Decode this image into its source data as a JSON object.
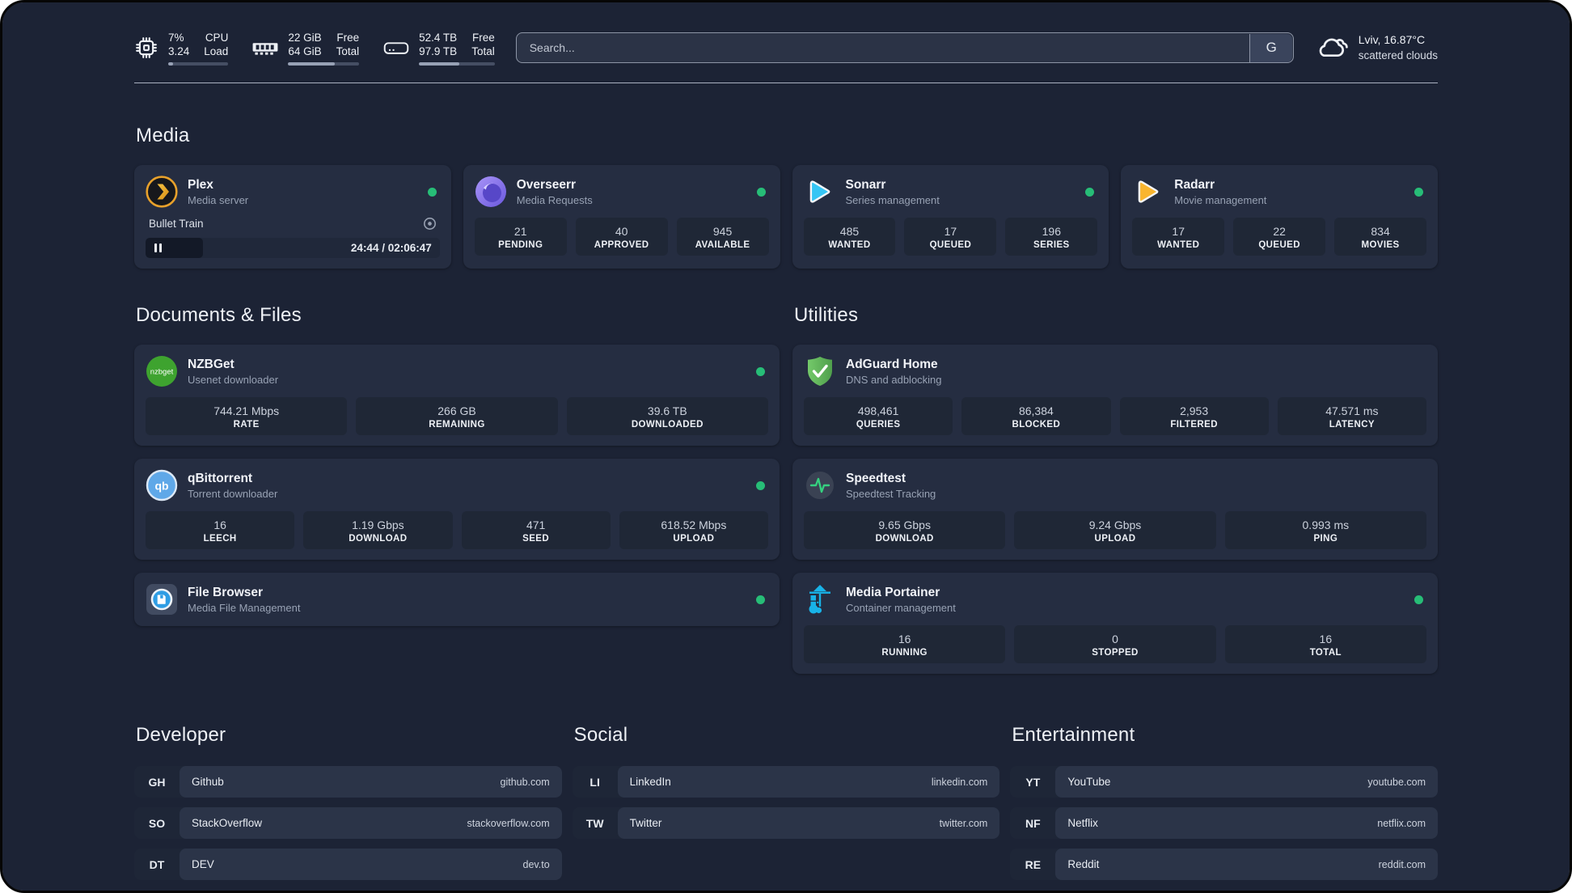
{
  "header": {
    "metrics": {
      "cpu": {
        "value1": "7%",
        "label1": "CPU",
        "value2": "3.24",
        "label2": "Load",
        "progress_pct": 8
      },
      "memory": {
        "value1": "22 GiB",
        "label1": "Free",
        "value2": "64 GiB",
        "label2": "Total",
        "progress_pct": 66
      },
      "disk": {
        "value1": "52.4 TB",
        "label1": "Free",
        "value2": "97.9 TB",
        "label2": "Total",
        "progress_pct": 53
      }
    },
    "search": {
      "placeholder": "Search...",
      "engine_button_label": "G"
    },
    "weather": {
      "location_temperature": "Lviv, 16.87°C",
      "condition": "scattered clouds"
    }
  },
  "sections": {
    "media": {
      "title": "Media",
      "apps": [
        {
          "name": "Plex",
          "description": "Media server",
          "status": "online",
          "session": {
            "now_playing": "Bullet Train",
            "state": "paused",
            "time_display": "24:44 / 02:06:47",
            "progress_pct": 19.5
          }
        },
        {
          "name": "Overseerr",
          "description": "Media Requests",
          "status": "online",
          "stats": [
            {
              "value": "21",
              "label": "PENDING"
            },
            {
              "value": "40",
              "label": "APPROVED"
            },
            {
              "value": "945",
              "label": "AVAILABLE"
            }
          ]
        },
        {
          "name": "Sonarr",
          "description": "Series management",
          "status": "online",
          "stats": [
            {
              "value": "485",
              "label": "WANTED"
            },
            {
              "value": "17",
              "label": "QUEUED"
            },
            {
              "value": "196",
              "label": "SERIES"
            }
          ]
        },
        {
          "name": "Radarr",
          "description": "Movie management",
          "status": "online",
          "stats": [
            {
              "value": "17",
              "label": "WANTED"
            },
            {
              "value": "22",
              "label": "QUEUED"
            },
            {
              "value": "834",
              "label": "MOVIES"
            }
          ]
        }
      ]
    },
    "documents": {
      "title": "Documents & Files",
      "apps": [
        {
          "name": "NZBGet",
          "description": "Usenet downloader",
          "status": "online",
          "stats": [
            {
              "value": "744.21 Mbps",
              "label": "RATE"
            },
            {
              "value": "266 GB",
              "label": "REMAINING"
            },
            {
              "value": "39.6 TB",
              "label": "DOWNLOADED"
            }
          ]
        },
        {
          "name": "qBittorrent",
          "description": "Torrent downloader",
          "status": "online",
          "stats": [
            {
              "value": "16",
              "label": "LEECH"
            },
            {
              "value": "1.19 Gbps",
              "label": "DOWNLOAD"
            },
            {
              "value": "471",
              "label": "SEED"
            },
            {
              "value": "618.52 Mbps",
              "label": "UPLOAD"
            }
          ]
        },
        {
          "name": "File Browser",
          "description": "Media File Management",
          "status": "online",
          "stats": []
        }
      ]
    },
    "utilities": {
      "title": "Utilities",
      "apps": [
        {
          "name": "AdGuard Home",
          "description": "DNS and adblocking",
          "stats": [
            {
              "value": "498,461",
              "label": "QUERIES"
            },
            {
              "value": "86,384",
              "label": "BLOCKED"
            },
            {
              "value": "2,953",
              "label": "FILTERED"
            },
            {
              "value": "47.571 ms",
              "label": "LATENCY"
            }
          ]
        },
        {
          "name": "Speedtest",
          "description": "Speedtest Tracking",
          "stats": [
            {
              "value": "9.65 Gbps",
              "label": "DOWNLOAD"
            },
            {
              "value": "9.24 Gbps",
              "label": "UPLOAD"
            },
            {
              "value": "0.993 ms",
              "label": "PING"
            }
          ]
        },
        {
          "name": "Media Portainer",
          "description": "Container management",
          "status": "online",
          "stats": [
            {
              "value": "16",
              "label": "RUNNING"
            },
            {
              "value": "0",
              "label": "STOPPED"
            },
            {
              "value": "16",
              "label": "TOTAL"
            }
          ]
        }
      ]
    },
    "bookmarks": [
      {
        "title": "Developer",
        "links": [
          {
            "abbr": "GH",
            "name": "Github",
            "domain": "github.com"
          },
          {
            "abbr": "SO",
            "name": "StackOverflow",
            "domain": "stackoverflow.com"
          },
          {
            "abbr": "DT",
            "name": "DEV",
            "domain": "dev.to"
          }
        ]
      },
      {
        "title": "Social",
        "links": [
          {
            "abbr": "LI",
            "name": "LinkedIn",
            "domain": "linkedin.com"
          },
          {
            "abbr": "TW",
            "name": "Twitter",
            "domain": "twitter.com"
          }
        ]
      },
      {
        "title": "Entertainment",
        "links": [
          {
            "abbr": "YT",
            "name": "YouTube",
            "domain": "youtube.com"
          },
          {
            "abbr": "NF",
            "name": "Netflix",
            "domain": "netflix.com"
          },
          {
            "abbr": "RE",
            "name": "Reddit",
            "domain": "reddit.com"
          }
        ]
      }
    ]
  },
  "colors": {
    "background": "#1c2335",
    "card": "#252d41",
    "stat_box": "#1f2736",
    "status_online": "#27bd77",
    "plex_accent": "#e8a12b",
    "sonarr_accent": "#35c5f4",
    "radarr_accent": "#f9b52f",
    "adguard_accent": "#5fb354",
    "portainer_accent": "#18b3e8",
    "speedtest_accent": "#35d07f",
    "nzbget_accent": "#3ea32f",
    "qbittorrent_accent": "#5fa8e8"
  }
}
